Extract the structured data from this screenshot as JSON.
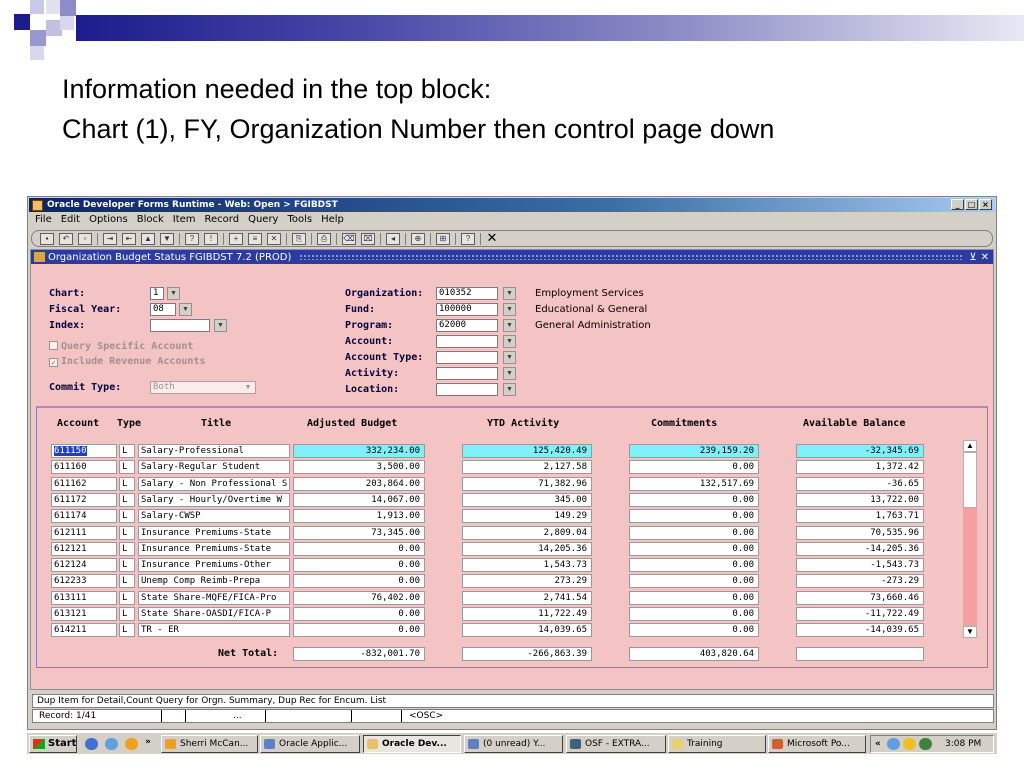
{
  "slide": {
    "title_line1": "Information needed in the top block:",
    "title_line2": "Chart (1), FY, Organization Number then control page down"
  },
  "window": {
    "title": "Oracle Developer Forms Runtime - Web: Open > FGIBDST",
    "controls": [
      "_",
      "□",
      "×"
    ],
    "menu": [
      "File",
      "Edit",
      "Options",
      "Block",
      "Item",
      "Record",
      "Query",
      "Tools",
      "Help"
    ]
  },
  "form": {
    "title": "Organization Budget Status  FGIBDST  7.2  (PROD)",
    "left": {
      "chart_label": "Chart:",
      "chart_value": "1",
      "fy_label": "Fiscal Year:",
      "fy_value": "08",
      "index_label": "Index:",
      "index_value": "",
      "query_specific": "Query Specific Account",
      "include_revenue": "Include Revenue Accounts",
      "commit_label": "Commit Type:",
      "commit_value": "Both"
    },
    "right": {
      "org_label": "Organization:",
      "org_value": "010352",
      "org_desc": "Employment Services",
      "fund_label": "Fund:",
      "fund_value": "100000",
      "fund_desc": "Educational & General",
      "program_label": "Program:",
      "program_value": "62000",
      "program_desc": "General Administration",
      "account_label": "Account:",
      "account_value": "",
      "account_type_label": "Account Type:",
      "account_type_value": "",
      "activity_label": "Activity:",
      "activity_value": "",
      "location_label": "Location:",
      "location_value": ""
    },
    "table": {
      "headers": [
        "Account",
        "Type",
        "Title",
        "Adjusted Budget",
        "YTD Activity",
        "Commitments",
        "Available Balance"
      ],
      "rows": [
        {
          "account": "611150",
          "type": "L",
          "title": "Salary-Professional",
          "budget": "332,234.00",
          "ytd": "125,420.49",
          "commit": "239,159.20",
          "avail": "-32,345.69"
        },
        {
          "account": "611160",
          "type": "L",
          "title": "Salary-Regular Student",
          "budget": "3,500.00",
          "ytd": "2,127.58",
          "commit": "0.00",
          "avail": "1,372.42"
        },
        {
          "account": "611162",
          "type": "L",
          "title": "Salary - Non Professional S",
          "budget": "203,864.00",
          "ytd": "71,382.96",
          "commit": "132,517.69",
          "avail": "-36.65"
        },
        {
          "account": "611172",
          "type": "L",
          "title": "Salary - Hourly/Overtime W",
          "budget": "14,067.00",
          "ytd": "345.00",
          "commit": "0.00",
          "avail": "13,722.00"
        },
        {
          "account": "611174",
          "type": "L",
          "title": "Salary-CWSP",
          "budget": "1,913.00",
          "ytd": "149.29",
          "commit": "0.00",
          "avail": "1,763.71"
        },
        {
          "account": "612111",
          "type": "L",
          "title": "Insurance Premiums-State",
          "budget": "73,345.00",
          "ytd": "2,809.04",
          "commit": "0.00",
          "avail": "70,535.96"
        },
        {
          "account": "612121",
          "type": "L",
          "title": "Insurance Premiums-State",
          "budget": "0.00",
          "ytd": "14,205.36",
          "commit": "0.00",
          "avail": "-14,205.36"
        },
        {
          "account": "612124",
          "type": "L",
          "title": "Insurance Premiums-Other",
          "budget": "0.00",
          "ytd": "1,543.73",
          "commit": "0.00",
          "avail": "-1,543.73"
        },
        {
          "account": "612233",
          "type": "L",
          "title": "Unemp Comp Reimb-Prepa",
          "budget": "0.00",
          "ytd": "273.29",
          "commit": "0.00",
          "avail": "-273.29"
        },
        {
          "account": "613111",
          "type": "L",
          "title": "State Share-MQFE/FICA-Pro",
          "budget": "76,402.00",
          "ytd": "2,741.54",
          "commit": "0.00",
          "avail": "73,660.46"
        },
        {
          "account": "613121",
          "type": "L",
          "title": "State Share-OASDI/FICA-P",
          "budget": "0.00",
          "ytd": "11,722.49",
          "commit": "0.00",
          "avail": "-11,722.49"
        },
        {
          "account": "614211",
          "type": "L",
          "title": "TR - ER",
          "budget": "0.00",
          "ytd": "14,039.65",
          "commit": "0.00",
          "avail": "-14,039.65"
        }
      ],
      "net_total_label": "Net Total:",
      "net_budget": "-832,001.70",
      "net_ytd": "-266,863.39",
      "net_commit": "403,820.64",
      "net_avail": ""
    },
    "status_message": "Dup Item for Detail,Count Query for Orgn. Summary, Dup Rec for Encum. List",
    "record": "Record: 1/41",
    "status_ellipsis": "...",
    "status_osc": "<OSC>"
  },
  "taskbar": {
    "start": "Start",
    "tasks": [
      "Sherri McCan...",
      "Oracle Applic...",
      "Oracle Dev...",
      "(0 unread) Y...",
      "OSF - EXTRA...",
      "Training",
      "Microsoft Po..."
    ],
    "time": "3:08 PM"
  },
  "colors": {
    "form_bg": "#f4c4c4",
    "title_blue": "#2b3c9e",
    "highlight_cyan": "#80f0f8"
  }
}
